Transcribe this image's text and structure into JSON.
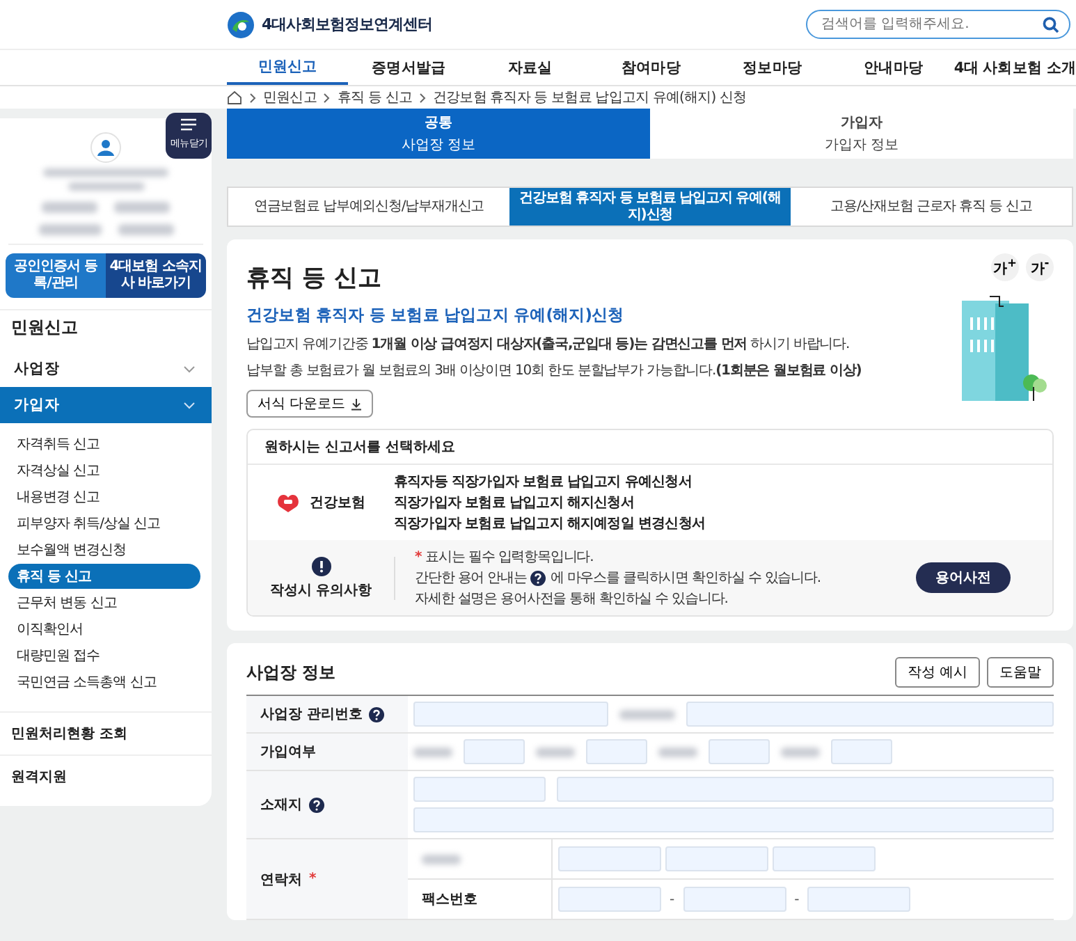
{
  "header": {
    "logo": "4대사회보험정보연계센터",
    "search": {
      "placeholder": "검색어를 입력해주세요."
    }
  },
  "nav": [
    {
      "label": "민원신고",
      "selected": true
    },
    {
      "label": "증명서발급",
      "selected": false
    },
    {
      "label": "자료실",
      "selected": false
    },
    {
      "label": "참여마당",
      "selected": false
    },
    {
      "label": "정보마당",
      "selected": false
    },
    {
      "label": "안내마당",
      "selected": false
    },
    {
      "label": "4대 사회보험 소개",
      "selected": false
    }
  ],
  "breadcrumb": [
    "민원신고",
    "휴직 등 신고",
    "건강보험 휴직자 등 보험료 납입고지 유예(해지) 신청"
  ],
  "sidebar": {
    "menu_button": "메뉴닫기",
    "quick_links": [
      "공인인증서 등록/관리",
      "4대보험 소속지사 바로가기"
    ],
    "section_title": "민원신고",
    "groups": [
      {
        "label": "사업장",
        "selected": false
      },
      {
        "label": "가입자",
        "selected": true,
        "children": [
          {
            "label": "자격취득 신고",
            "selected": false
          },
          {
            "label": "자격상실 신고",
            "selected": false
          },
          {
            "label": "내용변경 신고",
            "selected": false
          },
          {
            "label": "피부양자 취득/상실 신고",
            "selected": false
          },
          {
            "label": "보수월액 변경신청",
            "selected": false
          },
          {
            "label": "휴직 등 신고",
            "selected": true
          },
          {
            "label": "근무처 변동 신고",
            "selected": false
          },
          {
            "label": "이직확인서",
            "selected": false
          },
          {
            "label": "대량민원 접수",
            "selected": false
          },
          {
            "label": "국민연금 소득총액 신고",
            "selected": false
          }
        ]
      }
    ],
    "links": [
      "민원처리현황 조회",
      "원격지원"
    ]
  },
  "steps": [
    {
      "title": "공통",
      "label": "사업장 정보",
      "selected": true
    },
    {
      "title": "가입자",
      "label": "가입자 정보",
      "selected": false
    }
  ],
  "form_tabs": [
    {
      "label": "연금보험료 납부예외신청/납부재개신고",
      "selected": false
    },
    {
      "label": "건강보험 휴직자 등 보험료 납입고지 유예(해지)신청",
      "selected": true
    },
    {
      "label": "고용/산재보험 근로자 휴직 등 신고",
      "selected": false
    }
  ],
  "intro": {
    "title": "휴직 등 신고",
    "font_buttons": [
      "가$^{+}$",
      "가$^{-}$"
    ],
    "subtitle": "건강보험 휴직자 등 보험료 납입고지 유예(해지)신청",
    "paragraphs": [
      "납입고지 유예기간중 **1개월 이상 급여정지 대상자(출국,군입대 등)는 감면신고를 먼저** 하시기 바랍니다.",
      "납부할 총 보험료가 월 보험료의 3배 이상이면 10회 한도 분할납부가 가능합니다.**(1회분은 월보험료 이상)**"
    ],
    "download_button": "서식 다운로드"
  },
  "form_select": {
    "heading": "원하시는 신고서를 선택하세요",
    "insurer": "건강보험",
    "forms": [
      "휴직자등 직장가입자 보험료 납입고지 유예신청서",
      "직장가입자 보험료 납입고지 해지신청서",
      "직장가입자 보험료 납입고지 해지예정일 변경신청서"
    ]
  },
  "notes": {
    "title": "작성시 유의사항",
    "button": "용어사전",
    "lines": [
      {
        "kind": "required",
        "mark": "*",
        "text": "표시는 필수 입력항목입니다."
      },
      {
        "kind": "help",
        "before": "간단한 용어 안내는",
        "after": "에 마우스를 클릭하시면 확인하실 수 있습니다."
      },
      {
        "kind": "plain",
        "text": "자세한 설명은 용어사전을 통해 확인하실 수 있습니다."
      }
    ]
  },
  "business_info": {
    "title": "사업장 정보",
    "buttons": [
      "작성 예시",
      "도움말"
    ],
    "rows": [
      {
        "kind": "id",
        "label": "사업장 관리번호",
        "help": true
      },
      {
        "kind": "status",
        "label": "가입여부",
        "help": false
      },
      {
        "kind": "address",
        "label": "소재지",
        "help": true
      },
      {
        "kind": "contact",
        "label": "연락처",
        "help": false,
        "required_mark": "*",
        "sub_label": "팩스번호",
        "separators": [
          "-",
          "-"
        ]
      }
    ]
  }
}
